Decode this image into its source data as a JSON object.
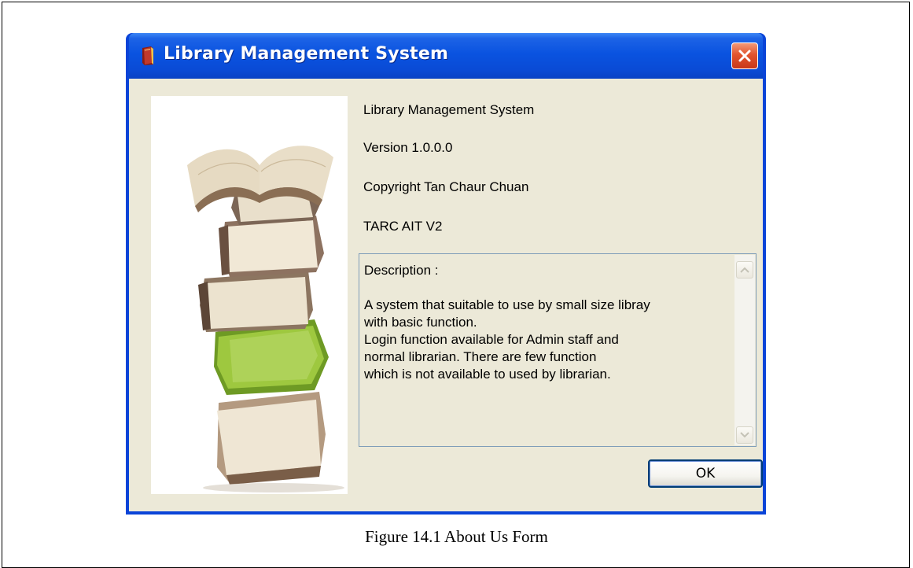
{
  "window": {
    "title": "Library Management System",
    "close_icon": "close-x-icon",
    "app_icon": "book-app-icon"
  },
  "about": {
    "product_name": "Library Management System",
    "version": "Version 1.0.0.0",
    "copyright": "Copyright Tan Chaur Chuan",
    "company": "TARC AIT V2",
    "description": "Description :\n\nA system that suitable to use by small size libray\nwith basic function.\nLogin function available for Admin staff and\nnormal librarian. There are few function\nwhich is not available to used by librarian."
  },
  "buttons": {
    "ok_label": "OK"
  },
  "image": {
    "subject": "stack-of-books-illustration"
  },
  "caption": "Figure 14.1 About Us Form",
  "colors": {
    "titlebar": "#0a53e0",
    "client_bg": "#ece9d8",
    "close_button": "#e2542e",
    "green_book": "#8fbf3a"
  }
}
